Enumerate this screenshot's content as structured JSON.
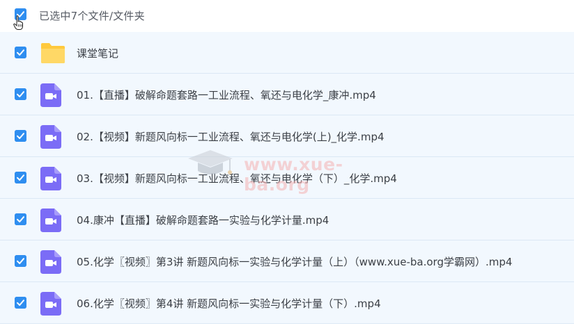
{
  "header": {
    "selection_summary": "已选中7个文件/文件夹",
    "select_all_checked": true
  },
  "files": [
    {
      "name": "课堂笔记",
      "type": "folder",
      "checked": true
    },
    {
      "name": "01.【直播】破解命题套路一工业流程、氧还与电化学_康冲.mp4",
      "type": "video",
      "checked": true
    },
    {
      "name": "02.【视频】新题风向标一工业流程、氧还与电化学(上)_化学.mp4",
      "type": "video",
      "checked": true
    },
    {
      "name": "03.【视频】新题风向标一工业流程、氧还与电化学（下）_化学.mp4",
      "type": "video",
      "checked": true
    },
    {
      "name": "04.康冲【直播】破解命题套路一实验与化学计量.mp4",
      "type": "video",
      "checked": true
    },
    {
      "name": "05.化学〖视频〗第3讲 新题风向标一实验与化学计量（上）（www.xue-ba.org学霸网）.mp4",
      "type": "video",
      "checked": true
    },
    {
      "name": "06.化学〖视频〗第4讲 新题风向标一实验与化学计量（下）.mp4",
      "type": "video",
      "checked": true
    }
  ],
  "watermark": {
    "text": "www.xue-ba.org"
  },
  "colors": {
    "accent": "#2f8ef0",
    "row_bg": "#f2f8fe",
    "folder": "#ffd252",
    "video": "#7b6cf6"
  }
}
